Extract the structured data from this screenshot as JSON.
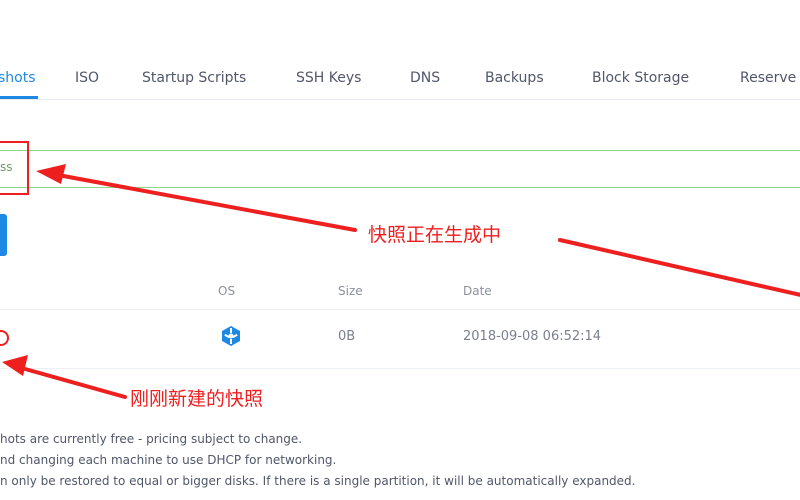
{
  "tabs": [
    {
      "label": "shots"
    },
    {
      "label": "ISO"
    },
    {
      "label": "Startup Scripts"
    },
    {
      "label": "SSH Keys"
    },
    {
      "label": "DNS"
    },
    {
      "label": "Backups"
    },
    {
      "label": "Block Storage"
    },
    {
      "label": "Reserve"
    }
  ],
  "status": {
    "text": "ss"
  },
  "table": {
    "headers": {
      "os": "OS",
      "size": "Size",
      "date": "Date"
    },
    "row": {
      "os_icon": "snowflake-os-icon",
      "size": "0B",
      "date": "2018-09-08 06:52:14"
    }
  },
  "annotations": {
    "in_progress": "快照正在生成中",
    "new_snapshot": "刚刚新建的快照"
  },
  "notes": [
    "hots are currently free - pricing subject to change.",
    "nd changing each machine to use DHCP for networking.",
    "n only be restored to equal or bigger disks. If there is a single partition, it will be automatically expanded."
  ],
  "colors": {
    "accent": "#1e88e5",
    "success_border": "#8fd48a",
    "annotation_red": "#ee1f1f"
  }
}
